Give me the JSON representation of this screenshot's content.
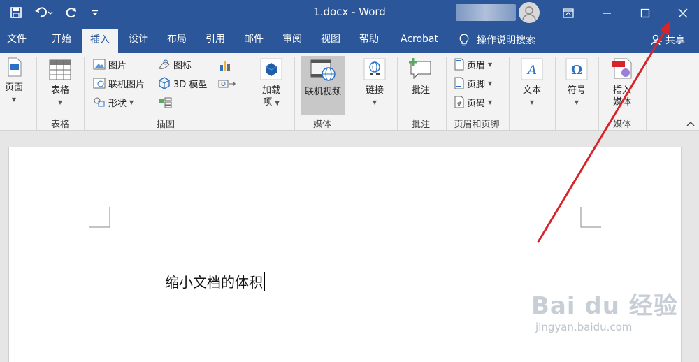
{
  "window": {
    "title": "1.docx - Word",
    "buttons": {
      "minimize": "minimize",
      "maximize": "maximize",
      "close": "close"
    }
  },
  "quick_access": [
    "save-icon",
    "undo-icon",
    "redo-icon",
    "customize-icon"
  ],
  "tabs": [
    {
      "label": "文件"
    },
    {
      "label": "开始"
    },
    {
      "label": "插入"
    },
    {
      "label": "设计"
    },
    {
      "label": "布局"
    },
    {
      "label": "引用"
    },
    {
      "label": "邮件"
    },
    {
      "label": "审阅"
    },
    {
      "label": "视图"
    },
    {
      "label": "帮助"
    },
    {
      "label": "Acrobat"
    }
  ],
  "active_tab": "插入",
  "tell_me": "操作说明搜索",
  "share": "共享",
  "ribbon": {
    "pages": {
      "label": "页面"
    },
    "tables": {
      "label": "表格",
      "group": "表格"
    },
    "illustrations": {
      "group": "插图",
      "items": [
        "图片",
        "联机图片",
        "形状",
        "图标",
        "3D 模型"
      ]
    },
    "addins": {
      "label1": "加载",
      "label2": "项"
    },
    "media": {
      "label": "联机视频",
      "group": "媒体"
    },
    "links": {
      "label": "链接"
    },
    "comments": {
      "label": "批注",
      "group": "批注"
    },
    "header_footer": {
      "items": [
        "页眉",
        "页脚",
        "页码"
      ],
      "group": "页眉和页脚"
    },
    "text": {
      "label": "文本"
    },
    "symbols": {
      "label": "符号"
    },
    "insert_media": {
      "label1": "插入",
      "label2": "媒体",
      "group": "媒体"
    }
  },
  "document": {
    "text": "缩小文档的体积"
  },
  "watermark": {
    "brand": "Bai du 经验",
    "url": "jingyan.baidu.com"
  },
  "colors": {
    "title_bar": "#2b579a",
    "ribbon": "#f3f3f3",
    "annotation_arrow": "#d8232a"
  }
}
